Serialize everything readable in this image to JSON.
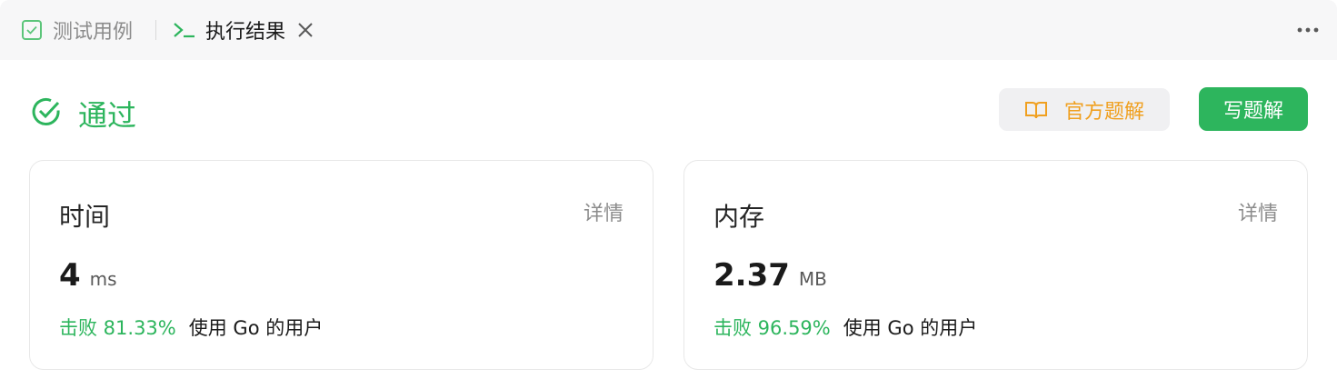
{
  "tabs": {
    "tests_label": "测试用例",
    "result_label": "执行结果"
  },
  "status": {
    "label": "通过",
    "color": "#2db55d"
  },
  "actions": {
    "official_solution": "官方题解",
    "write_solution": "写题解"
  },
  "cards": {
    "time": {
      "title": "时间",
      "detail": "详情",
      "value": "4",
      "unit": "ms",
      "beat": "击败 81.33%",
      "suffix": "使用 Go 的用户"
    },
    "memory": {
      "title": "内存",
      "detail": "详情",
      "value": "2.37",
      "unit": "MB",
      "beat": "击败 96.59%",
      "suffix": "使用 Go 的用户"
    }
  },
  "icons": {
    "tests": "checkbox-icon",
    "result": "terminal-icon",
    "close": "close-icon",
    "more": "more-horizontal-icon",
    "status": "check-circle-icon",
    "solution": "book-icon"
  }
}
